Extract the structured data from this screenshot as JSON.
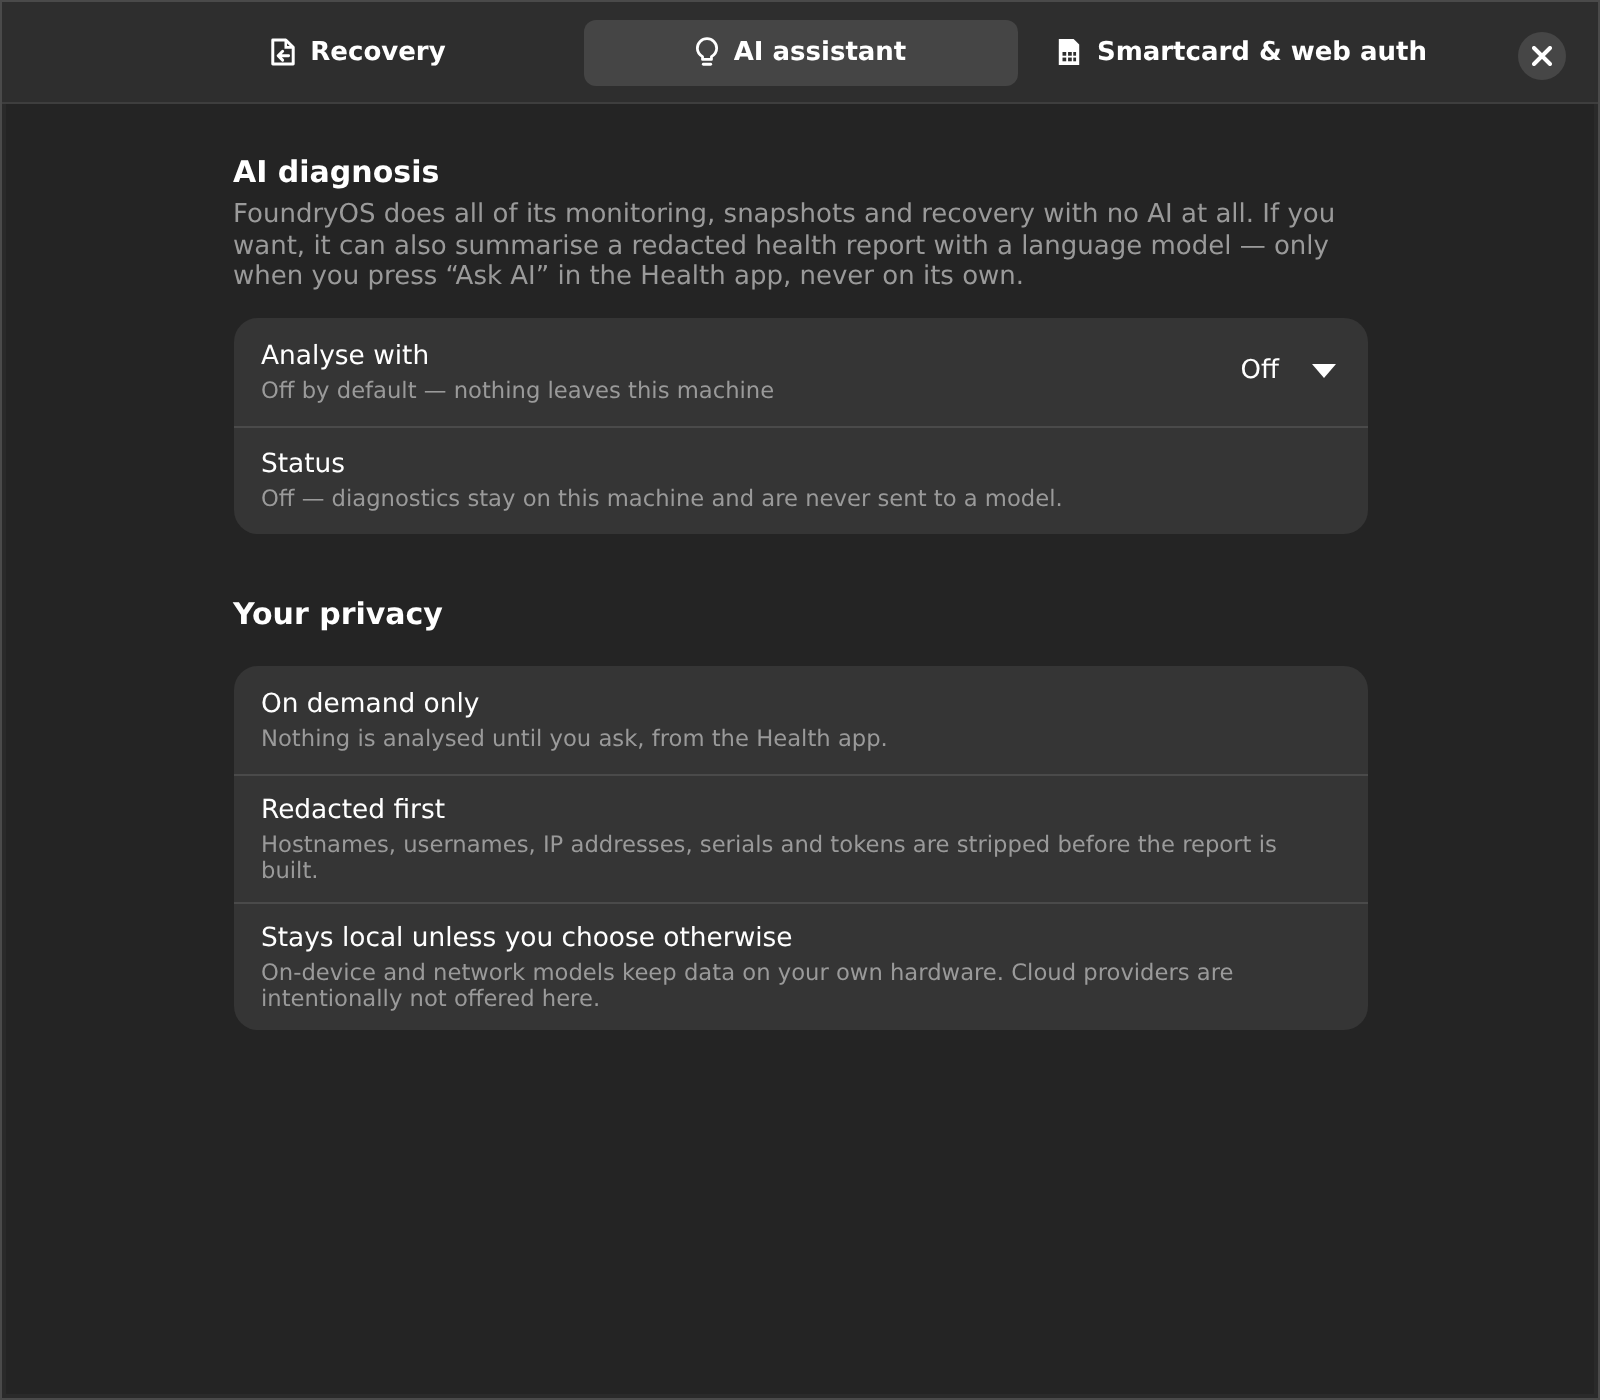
{
  "tabs": [
    {
      "label": "Recovery",
      "kind": "recovery",
      "selected": false
    },
    {
      "label": "AI assistant",
      "kind": "assistant",
      "selected": true
    },
    {
      "label": "Smartcard & web auth",
      "kind": "smartcard",
      "selected": false
    }
  ],
  "sections": [
    {
      "title": "AI diagnosis",
      "description": "FoundryOS does all of its monitoring, snapshots and recovery with no AI at all. If you want, it can also summarise a redacted health report with a language model — only when you press “Ask AI” in the Health app, never on its own.",
      "rows": [
        {
          "kind": "dropdown",
          "title": "Analyse with",
          "subtitle": "Off by default — nothing leaves this machine",
          "value": "Off"
        },
        {
          "kind": "info",
          "title": "Status",
          "subtitle": "Off — diagnostics stay on this machine and are never sent to a model."
        }
      ]
    },
    {
      "title": "Your privacy",
      "rows": [
        {
          "kind": "info",
          "title": "On demand only",
          "subtitle": "Nothing is analysed until you ask, from the Health app."
        },
        {
          "kind": "info",
          "title": "Redacted first",
          "subtitle": "Hostnames, usernames, IP addresses, serials and tokens are stripped before the report is built."
        },
        {
          "kind": "info",
          "title": "Stays local unless you choose otherwise",
          "subtitle": "On-device and network models keep data on your own hardware. Cloud providers are intentionally not offered here."
        }
      ]
    }
  ]
}
